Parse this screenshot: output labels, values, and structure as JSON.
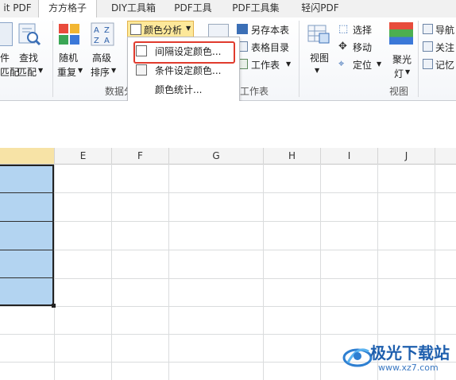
{
  "tabs": [
    "it PDF",
    "方方格子",
    "DIY工具箱",
    "PDF工具",
    "PDF工具集",
    "轻闪PDF"
  ],
  "active_tab": "方方格子",
  "ribbon": {
    "left_partial": {
      "line1": "件",
      "line2": "匹配"
    },
    "find": {
      "line1": "查找",
      "line2": "匹配"
    },
    "random": {
      "line1": "随机",
      "line2": "重复"
    },
    "sort": {
      "line1": "高级",
      "line2": "排序"
    },
    "color_analysis": "颜色分析",
    "save_sheet": "另存本表",
    "sheet_dir": "表格目录",
    "worksheet": "工作表",
    "view": "视图",
    "select": "选择",
    "move": "移动",
    "locate": "定位",
    "spotlight": {
      "line1": "聚光",
      "line2": "灯"
    },
    "navigate": "导航",
    "focus": "关注",
    "memo": "记忆",
    "group_data": "数据分",
    "group_sheet": "工作表",
    "group_view": "视图"
  },
  "menu": {
    "items": [
      "间隔设定颜色...",
      "条件设定颜色...",
      "颜色统计..."
    ]
  },
  "sheet": {
    "columns": [
      "E",
      "F",
      "G",
      "H",
      "I",
      "J"
    ]
  },
  "watermark": {
    "title": "极光下载站",
    "url": "www.xz7.com"
  },
  "colors": {
    "accent_red": "#e03b2d",
    "selection": "#b3d4f1",
    "highlight_button": "#fde89a"
  }
}
